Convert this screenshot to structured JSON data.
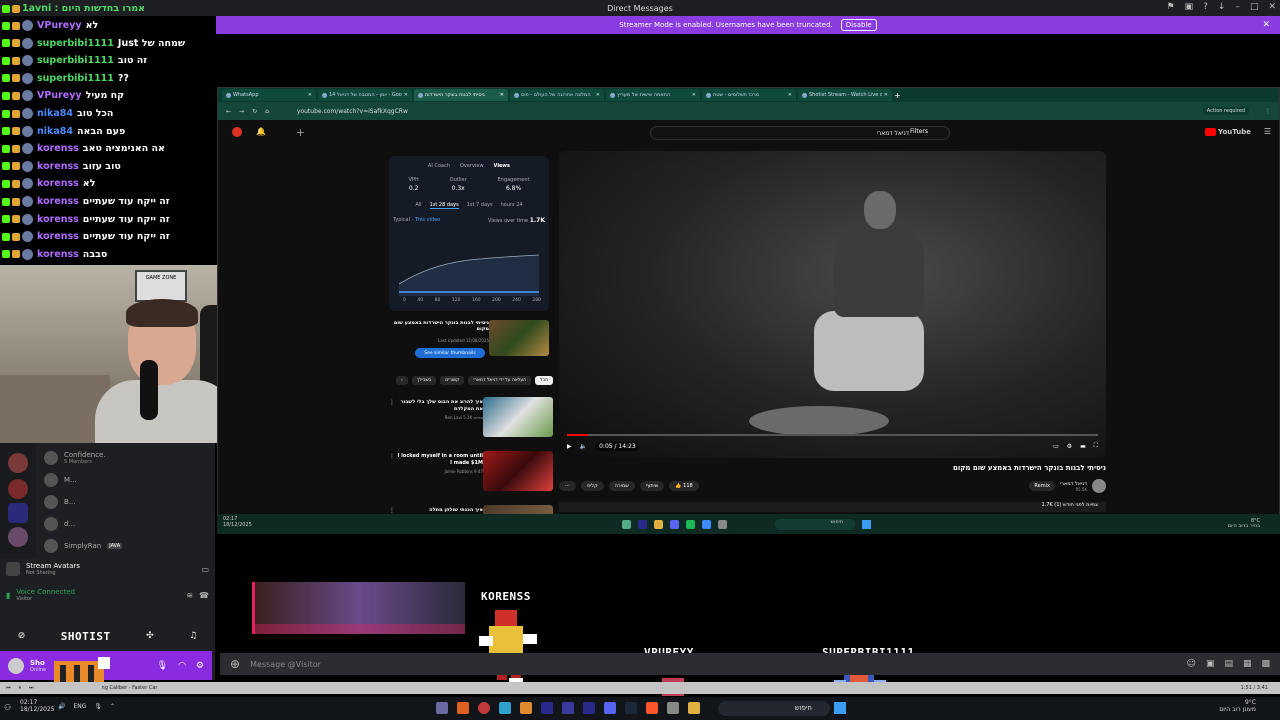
{
  "os": {
    "window_title": "Direct Messages",
    "top_left_message": "1avni : אמרו בחדשות היום"
  },
  "banner": {
    "text": "Streamer Mode is enabled. Usernames have been truncated.",
    "button": "Disable"
  },
  "chat": [
    {
      "user": "VPureyy",
      "color": "#b06cff",
      "msg": "לא"
    },
    {
      "user": "superbibi1111",
      "color": "#4cd964",
      "msg": "Just שמחה של"
    },
    {
      "user": "superbibi1111",
      "color": "#4cd964",
      "msg": "זה טוב"
    },
    {
      "user": "superbibi1111",
      "color": "#4cd964",
      "msg": "??"
    },
    {
      "user": "VPureyy",
      "color": "#b06cff",
      "msg": "קח מעיל"
    },
    {
      "user": "nika84",
      "color": "#4a8cff",
      "msg": "הכל טוב"
    },
    {
      "user": "nika84",
      "color": "#4a8cff",
      "msg": "פעם הבאה"
    },
    {
      "user": "korenss",
      "color": "#b06cff",
      "msg": "אה האנימציה טאב"
    },
    {
      "user": "korenss",
      "color": "#b06cff",
      "msg": "טוב עזוב"
    },
    {
      "user": "korenss",
      "color": "#b06cff",
      "msg": "לא"
    },
    {
      "user": "korenss",
      "color": "#b06cff",
      "msg": "זה ייקח עוד שעתיים"
    },
    {
      "user": "korenss",
      "color": "#b06cff",
      "msg": "זה ייקח עוד שעתיים"
    },
    {
      "user": "korenss",
      "color": "#b06cff",
      "msg": "זה ייקח עוד שעתיים"
    },
    {
      "user": "korenss",
      "color": "#b06cff",
      "msg": "סבבה"
    }
  ],
  "webcam": {
    "sign": "GAME ZONE"
  },
  "discord": {
    "members": [
      {
        "name": "Confidence.",
        "sub": "5 Members"
      },
      {
        "name": "M...",
        "sub": ""
      },
      {
        "name": "B...",
        "sub": ""
      },
      {
        "name": "d...",
        "sub": ""
      },
      {
        "name": "SimplyRan",
        "sub": "JAVA"
      }
    ],
    "stream_avatars": "Stream Avatars",
    "stream_avatars_sub": "Not Sharing",
    "voice_connected": "Voice Connected",
    "voice_channel": "Visitor",
    "shotist": "SHOTIST",
    "user": "Sho",
    "user_sub": "Online",
    "message_placeholder": "Message @Visitor"
  },
  "browser": {
    "tabs": [
      {
        "label": "WhatsApp",
        "active": false
      },
      {
        "label": "יומן - המטבח של דניאל 14 - Google",
        "active": false
      },
      {
        "label": "ניסיתי לבנות בונקר הישרדות",
        "active": true
      },
      {
        "label": "המלצה אחרונה של העולם - פוס",
        "active": false
      },
      {
        "label": "התאמה אישית של מעריץ",
        "active": false
      },
      {
        "label": "מרכז תשלומים - שטח",
        "active": false
      },
      {
        "label": "Shotist Stream - Watch Live on",
        "active": false
      }
    ],
    "url": "youtube.com/watch?v=iSafkXqgCRw",
    "action_required": "Action required"
  },
  "youtube": {
    "search_query": "דניאל דמארי",
    "filters": "Filters",
    "logo": "YouTube",
    "analytics": {
      "tabs": [
        "AI Coach",
        "Overview",
        "Views"
      ],
      "metrics": [
        {
          "label": "VPH",
          "value": "0.2"
        },
        {
          "label": "Outlier",
          "value": "0.3x"
        },
        {
          "label": "Engagement",
          "value": "6.8%"
        }
      ],
      "ranges": [
        "All",
        "1st 28 days",
        "1st 7 days",
        "hours 24"
      ],
      "typical": "Typical",
      "this_video": "This video",
      "views_over_time": "Views over time",
      "total": "1.7K"
    },
    "side_title": "ניסיתי לבנות בונקר הישרדות באמצע שום מקום",
    "side_updated": "Last Updated 11/08/2025",
    "see_thumbs": "See similar thumbnails",
    "chips": [
      "הכל",
      "העלאה על ידי דניאל דמארי",
      "קשורים",
      "בשבילך"
    ],
    "recs": [
      {
        "title": "איך להרוג את הבוס שלך בלי לשבור את המקלדת",
        "author": "Ben Lavi",
        "meta": "5.1K צפיות"
      },
      {
        "title": "I locked myself in a room until I made $1M",
        "author": "Jamie Robbins",
        "meta": "9:47"
      },
      {
        "title": "איך הכנתי שולחן מתלה",
        "author": "",
        "meta": ""
      }
    ],
    "video_time": "0:05 / 14:23",
    "video_title": "ניסיתי לבנות בונקר הישרדות באמצע שום מקום",
    "channel": "דניאל דמארי",
    "channel_subs": "95.5K",
    "remix": "Remix",
    "like_count": "118",
    "actions": [
      "שיתוף",
      "שמירה",
      "קליפ"
    ],
    "desc": "1.7K צפיות לפני חודש (1)"
  },
  "inner_taskbar": {
    "time": "02:17",
    "date": "18/12/2025",
    "search": "חיפוש",
    "weather": "8°C",
    "weather_sub": "בהיר ברוב היום"
  },
  "sprites": {
    "korenss": "KORENSS",
    "vpureyy": "VPUREYY",
    "superbibi": "SUPERBIBI1111"
  },
  "music": {
    "track": "ng Caliber - Faster Car",
    "time": "1:51 / 3:41"
  },
  "taskbar": {
    "time": "02:17",
    "date": "18/12/2025",
    "lang": "ENG",
    "search": "חיפוש",
    "weather": "9°C",
    "weather_sub": "מעונן רוב היום"
  }
}
